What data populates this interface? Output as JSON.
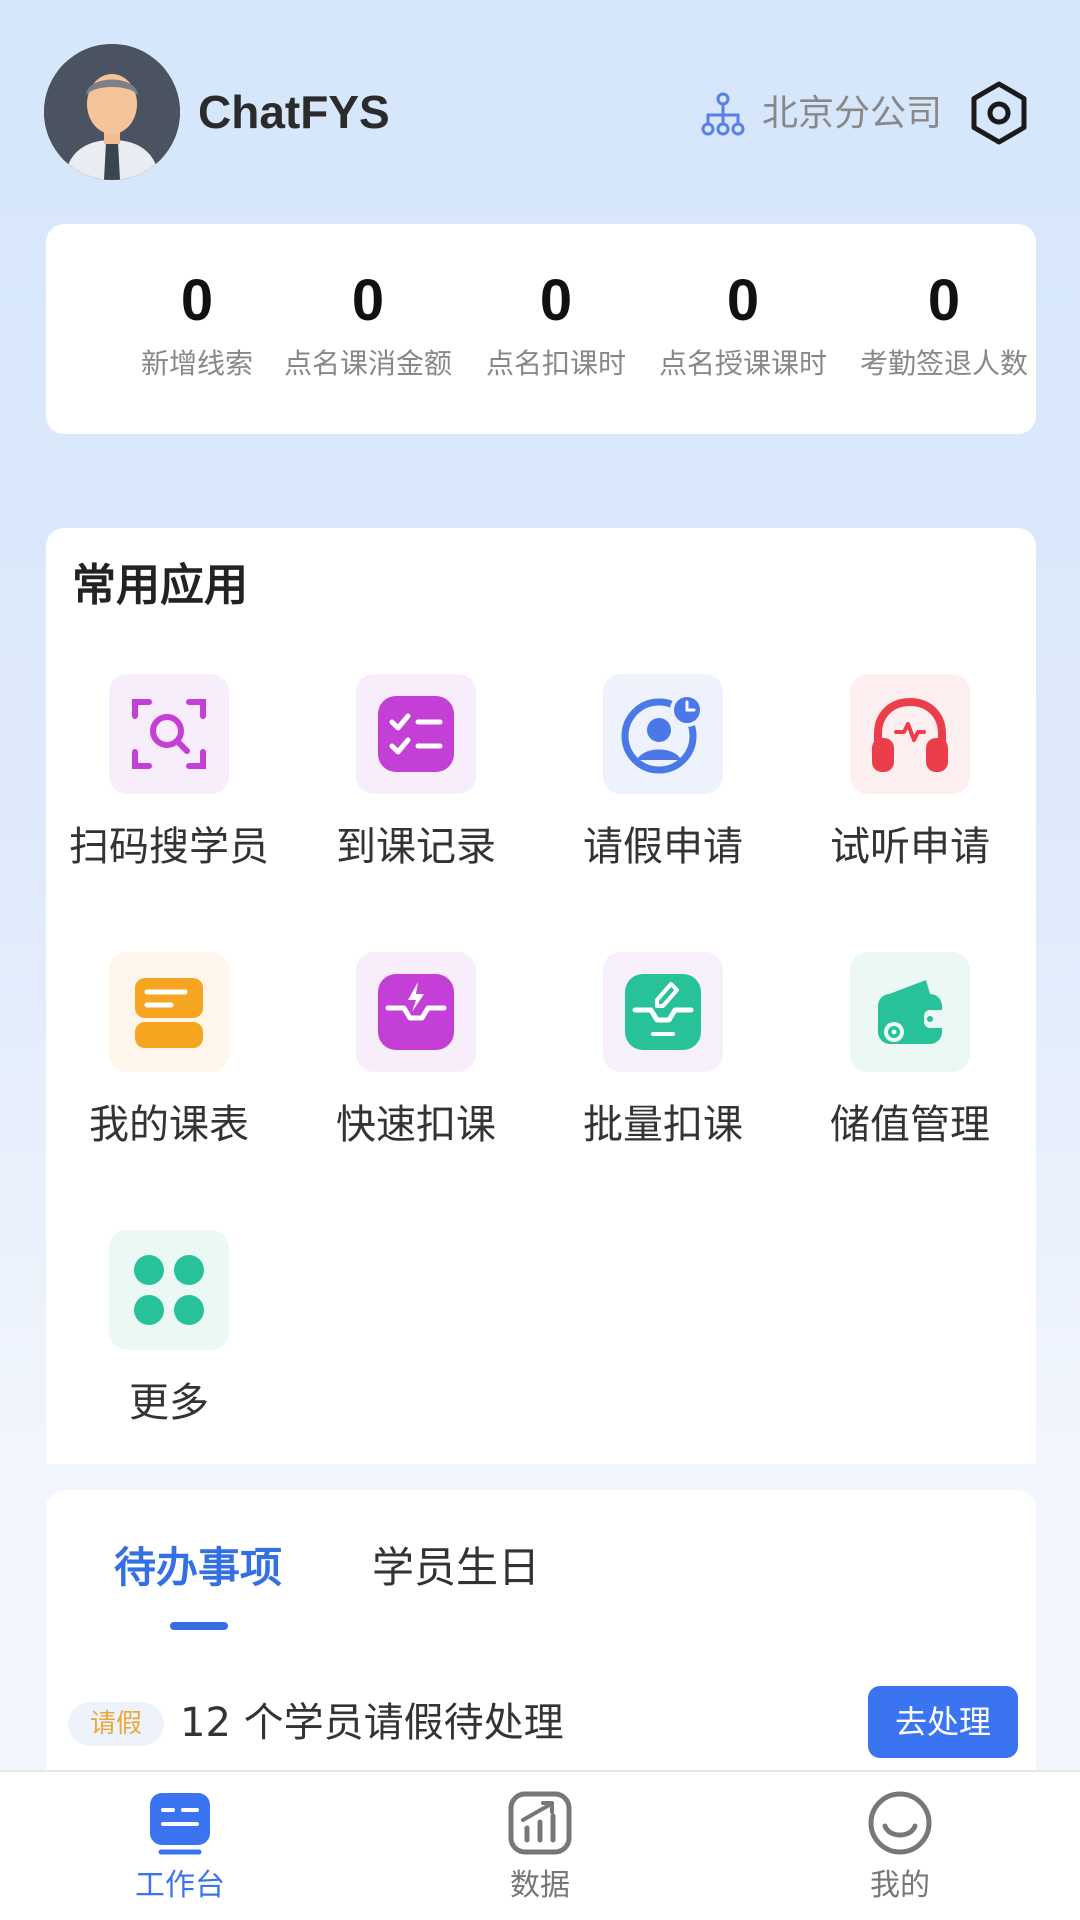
{
  "header": {
    "user_name": "ChatFYS",
    "org_label": "北京分公司"
  },
  "stats": [
    {
      "value": "0",
      "label": "新增线索"
    },
    {
      "value": "0",
      "label": "点名课消金额"
    },
    {
      "value": "0",
      "label": "点名扣课时"
    },
    {
      "value": "0",
      "label": "点名授课课时"
    },
    {
      "value": "0",
      "label": "考勤签退人数"
    }
  ],
  "apps": {
    "title": "常用应用",
    "items": [
      {
        "label": "扫码搜学员",
        "icon": "scan-search-icon",
        "color": "#c43fd6"
      },
      {
        "label": "到课记录",
        "icon": "checklist-icon",
        "color": "#c43fd6"
      },
      {
        "label": "请假申请",
        "icon": "user-clock-icon",
        "color": "#4a78e8"
      },
      {
        "label": "试听申请",
        "icon": "headphones-icon",
        "color": "#ec3d4a"
      },
      {
        "label": "我的课表",
        "icon": "schedule-icon",
        "color": "#f5a51f"
      },
      {
        "label": "快速扣课",
        "icon": "lightning-tray-icon",
        "color": "#c43fd6"
      },
      {
        "label": "批量扣课",
        "icon": "edit-tray-icon",
        "color": "#27c19a"
      },
      {
        "label": "储值管理",
        "icon": "wallet-gear-icon",
        "color": "#27c19a"
      },
      {
        "label": "更多",
        "icon": "grid-more-icon",
        "color": "#27c19a"
      }
    ]
  },
  "tasks": {
    "tabs": [
      {
        "label": "待办事项",
        "active": true
      },
      {
        "label": "学员生日",
        "active": false
      }
    ],
    "items": [
      {
        "badge": "请假",
        "text": "12 个学员请假待处理",
        "action": "去处理"
      }
    ]
  },
  "nav": [
    {
      "label": "工作台",
      "icon": "workbench-icon",
      "active": true
    },
    {
      "label": "数据",
      "icon": "data-chart-icon",
      "active": false
    },
    {
      "label": "我的",
      "icon": "profile-smile-icon",
      "active": false
    }
  ],
  "colors": {
    "primary": "#3b74f0",
    "badge_text": "#e9a93a"
  }
}
